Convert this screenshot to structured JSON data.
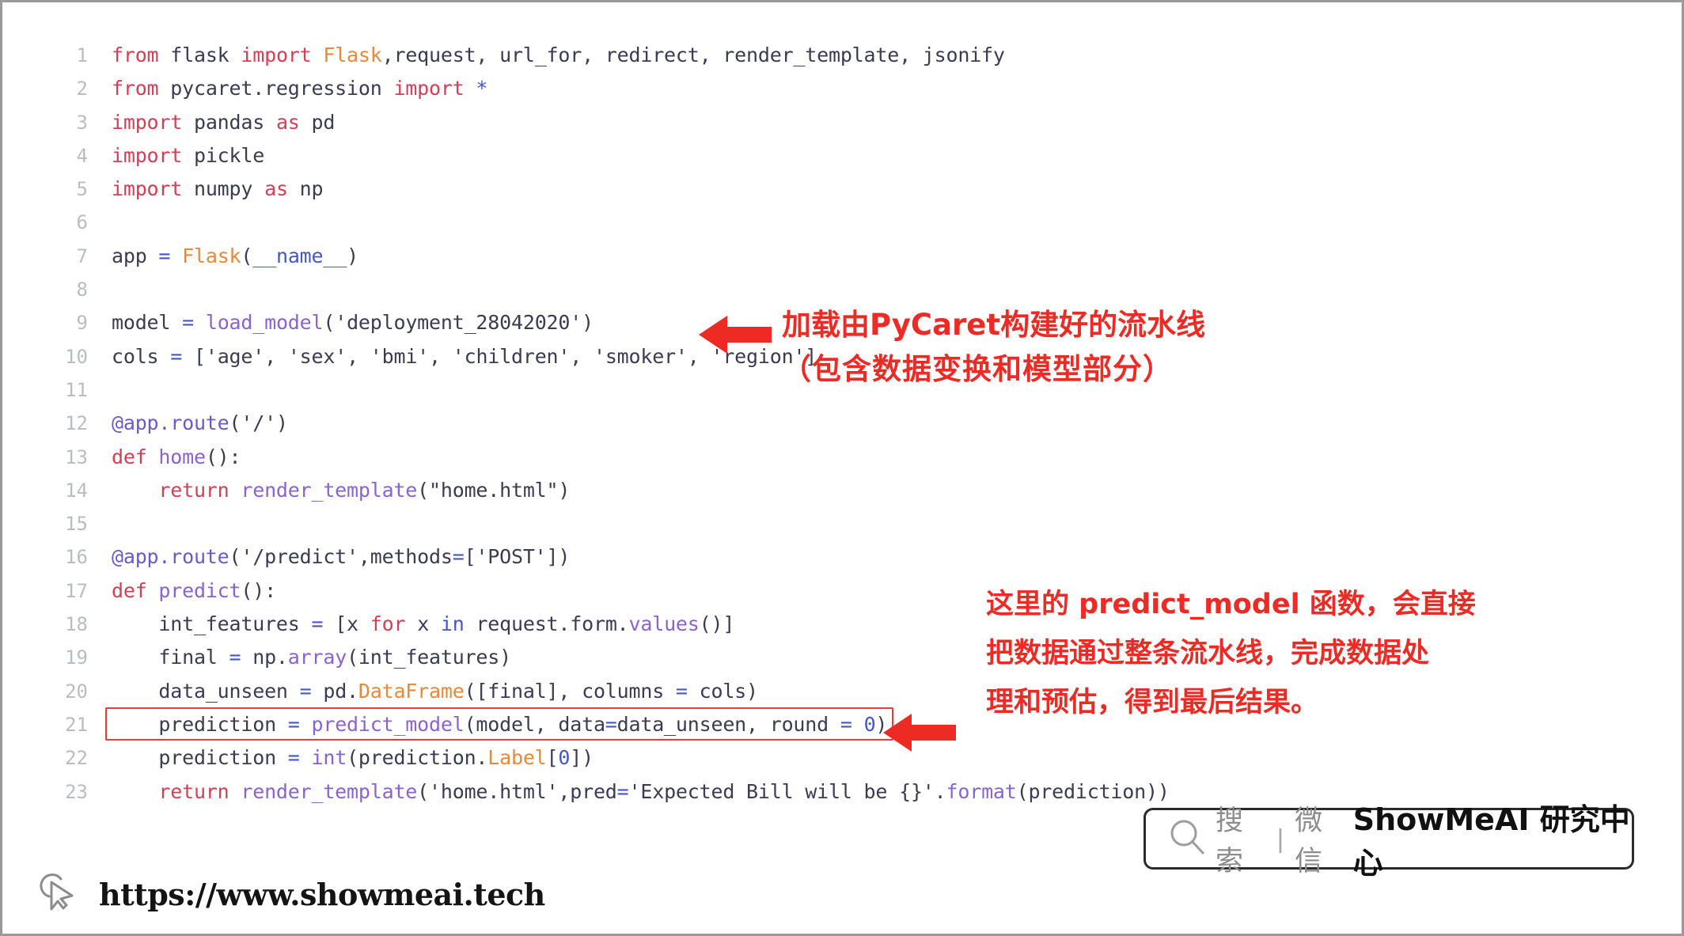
{
  "page": {
    "background": "#ffffff",
    "border_color": "#9a9a9a"
  },
  "code": {
    "language": "python",
    "lines": [
      {
        "n": "1",
        "text": "from flask import Flask,request, url_for, redirect, render_template, jsonify"
      },
      {
        "n": "2",
        "text": "from pycaret.regression import *"
      },
      {
        "n": "3",
        "text": "import pandas as pd"
      },
      {
        "n": "4",
        "text": "import pickle"
      },
      {
        "n": "5",
        "text": "import numpy as np"
      },
      {
        "n": "6",
        "text": ""
      },
      {
        "n": "7",
        "text": "app = Flask(__name__)"
      },
      {
        "n": "8",
        "text": ""
      },
      {
        "n": "9",
        "text": "model = load_model('deployment_28042020')"
      },
      {
        "n": "10",
        "text": "cols = ['age', 'sex', 'bmi', 'children', 'smoker', 'region']"
      },
      {
        "n": "11",
        "text": ""
      },
      {
        "n": "12",
        "text": "@app.route('/')"
      },
      {
        "n": "13",
        "text": "def home():"
      },
      {
        "n": "14",
        "text": "    return render_template(\"home.html\")"
      },
      {
        "n": "15",
        "text": ""
      },
      {
        "n": "16",
        "text": "@app.route('/predict',methods=['POST'])"
      },
      {
        "n": "17",
        "text": "def predict():"
      },
      {
        "n": "18",
        "text": "    int_features = [x for x in request.form.values()]"
      },
      {
        "n": "19",
        "text": "    final = np.array(int_features)"
      },
      {
        "n": "20",
        "text": "    data_unseen = pd.DataFrame([final], columns = cols)"
      },
      {
        "n": "21",
        "text": "    prediction = predict_model(model, data=data_unseen, round = 0)"
      },
      {
        "n": "22",
        "text": "    prediction = int(prediction.Label[0])"
      },
      {
        "n": "23",
        "text": "    return render_template('home.html',pred='Expected Bill will be {}'.format(prediction))"
      }
    ],
    "highlighted_line": "21",
    "highlight_color": "#ee3b33",
    "line_number_color": "#b9bcc2"
  },
  "annotations": {
    "color": "#ee2a24",
    "first": {
      "line1": "加载由PyCaret构建好的流水线",
      "line2": "（包含数据变换和模型部分）",
      "arrow": "left-arrow-icon"
    },
    "second": {
      "line1": "这里的 predict_model 函数，会直接",
      "line2": "把数据通过整条流水线，完成数据处",
      "line3": "理和预估，得到最后结果。",
      "arrow": "left-arrow-icon"
    }
  },
  "search_badge": {
    "icon": "search-icon",
    "search_label": "搜索",
    "separator": "|",
    "channel_label": "微信",
    "brand": "ShowMeAI 研究中心"
  },
  "footer": {
    "icon": "cursor-pointer-icon",
    "url": "https://www.showmeai.tech"
  }
}
